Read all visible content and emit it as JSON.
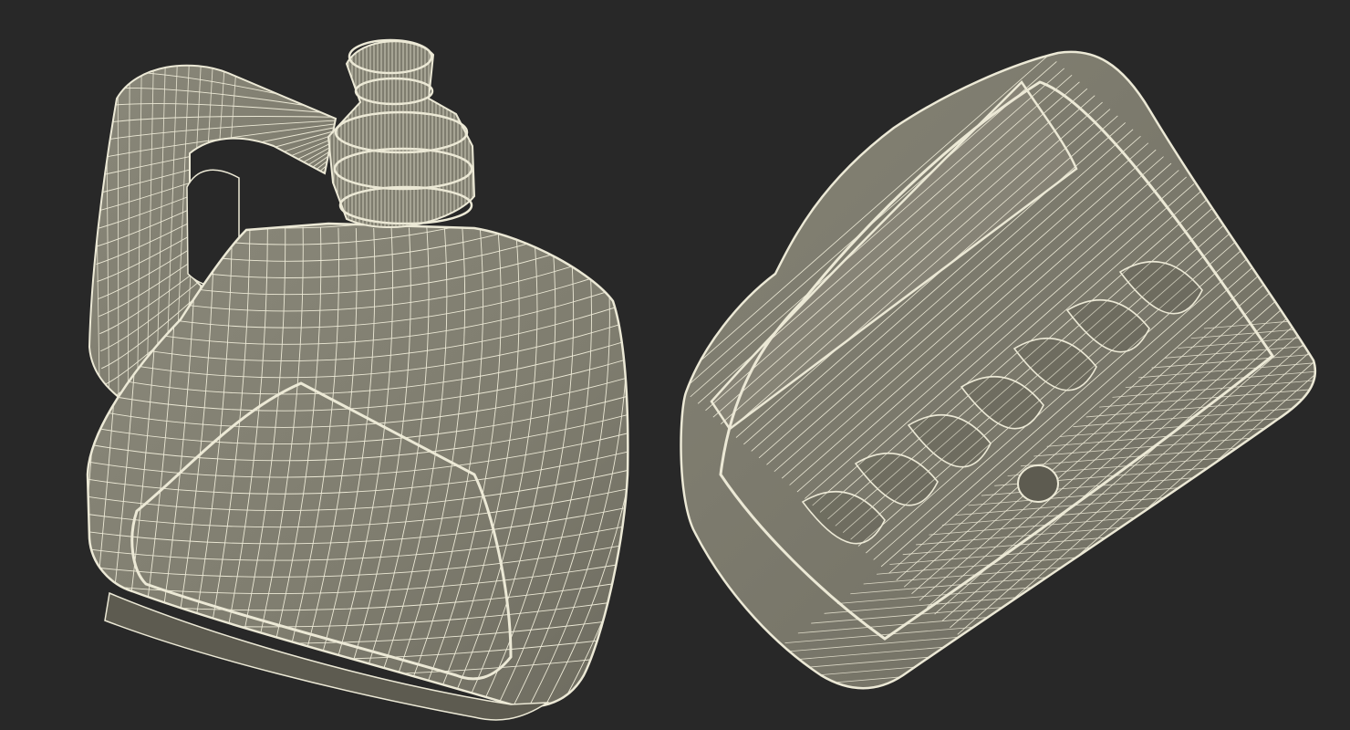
{
  "scene": {
    "background_color": "#282828",
    "surface_color": "#7f7d6f",
    "surface_shadow_color": "#5d5b50",
    "wire_color": "#ece9d6",
    "hole_color": "#282828"
  },
  "models": [
    {
      "name": "jug-front-three-quarter-view"
    },
    {
      "name": "jug-bottom-view"
    }
  ]
}
